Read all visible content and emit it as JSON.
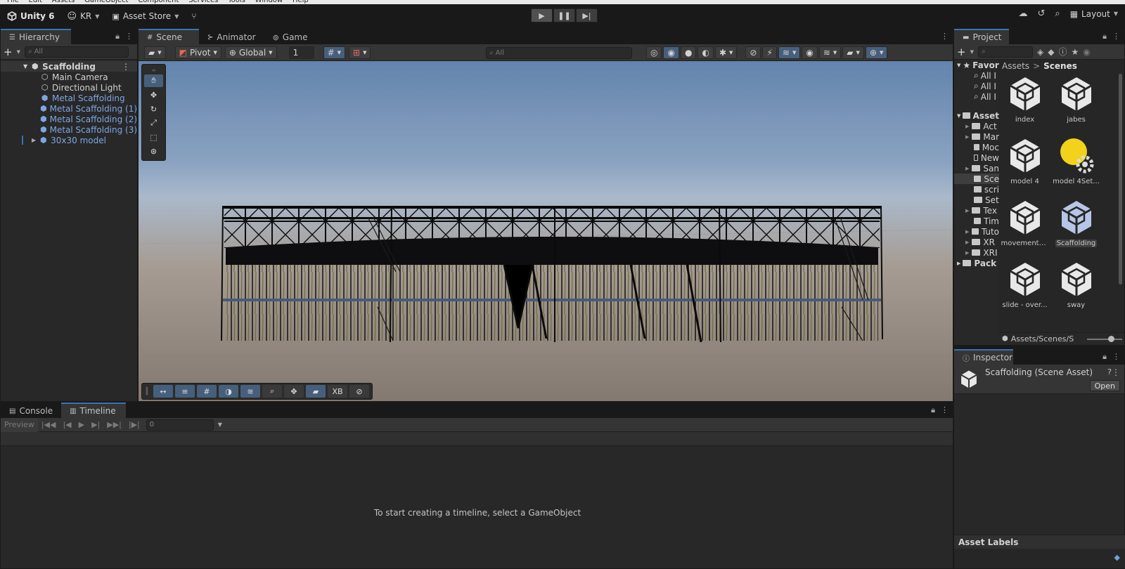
{
  "menu": [
    "File",
    "Edit",
    "Assets",
    "GameObject",
    "Component",
    "Services",
    "Tools",
    "Window",
    "Help"
  ],
  "toolbar": {
    "unity_label": "Unity 6",
    "account": "KR",
    "asset_store": "Asset Store",
    "layout": "Layout"
  },
  "hierarchy": {
    "tab": "Hierarchy",
    "search_placeholder": "All",
    "scene": "Scaffolding",
    "items": [
      {
        "label": "Main Camera",
        "blue": false
      },
      {
        "label": "Directional Light",
        "blue": false
      },
      {
        "label": "Metal Scaffolding",
        "blue": true
      },
      {
        "label": "Metal Scaffolding (1)",
        "blue": true
      },
      {
        "label": "Metal Scaffolding (2)",
        "blue": true
      },
      {
        "label": "Metal Scaffolding (3)",
        "blue": true
      },
      {
        "label": "30x30 model",
        "blue": true
      }
    ]
  },
  "scene_tabs": {
    "scene": "Scene",
    "animator": "Animator",
    "game": "Game"
  },
  "scene_toolbar": {
    "pivot": "Pivot",
    "global": "Global",
    "grid_value": "1",
    "search_placeholder": "All"
  },
  "overlay": {
    "xb": "XB"
  },
  "bottom": {
    "console": "Console",
    "timeline": "Timeline",
    "preview": "Preview",
    "frame": "0",
    "message": "To start creating a timeline, select a GameObject"
  },
  "project": {
    "tab": "Project",
    "breadcrumb": [
      "Assets",
      "Scenes"
    ],
    "favorites": "Favori",
    "fav_items": [
      "All I",
      "All I",
      "All I"
    ],
    "assets_root": "Asset",
    "folders": [
      {
        "label": "Act",
        "expandable": true
      },
      {
        "label": "Mar",
        "expandable": true
      },
      {
        "label": "Moc",
        "expandable": false
      },
      {
        "label": "New",
        "expandable": false
      },
      {
        "label": "San",
        "expandable": true
      },
      {
        "label": "Sce",
        "expandable": false,
        "selected": true
      },
      {
        "label": "scri",
        "expandable": false
      },
      {
        "label": "Set",
        "expandable": false
      },
      {
        "label": "Tex",
        "expandable": true
      },
      {
        "label": "Tim",
        "expandable": false
      },
      {
        "label": "Tuto",
        "expandable": true
      },
      {
        "label": "XR",
        "expandable": true
      },
      {
        "label": "XRI",
        "expandable": true
      }
    ],
    "packages": "Pack",
    "assets": [
      {
        "label": "index",
        "kind": "unity"
      },
      {
        "label": "jabes",
        "kind": "unity"
      },
      {
        "label": "model 4",
        "kind": "unity"
      },
      {
        "label": "model 4Set...",
        "kind": "lighting"
      },
      {
        "label": "movementT...",
        "kind": "unity"
      },
      {
        "label": "Scaffolding",
        "kind": "unity",
        "selected": true
      },
      {
        "label": "slide - over...",
        "kind": "unity"
      },
      {
        "label": "sway",
        "kind": "unity"
      }
    ],
    "footer_path": "Assets/Scenes/S"
  },
  "inspector": {
    "tab": "Inspector",
    "title": "Scaffolding (Scene Asset)",
    "open": "Open",
    "asset_labels": "Asset Labels"
  }
}
